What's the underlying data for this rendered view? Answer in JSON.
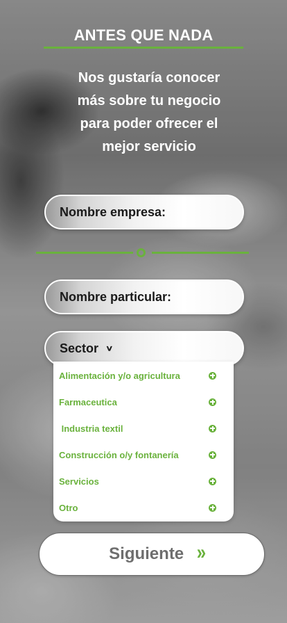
{
  "header": {
    "title": "ANTES QUE NADA",
    "intro": "Nos gustaría conocer\n más sobre tu negocio\npara poder ofrecer el\nmejor servicio"
  },
  "form": {
    "company_label": "Nombre empresa:",
    "individual_label": "Nombre particular:",
    "sector_label": "Sector",
    "sector_chevron": "∨",
    "sector_options": [
      "Alimentación y/o agricultura",
      "Farmaceutica",
      " Industria textil",
      "Construcción o/y fontanería",
      "Servicios",
      "Otro"
    ]
  },
  "footer": {
    "next_label": "Siguiente",
    "next_icon": "»"
  },
  "colors": {
    "accent": "#6ab23d",
    "text_dark": "#1a1a1a",
    "button_text": "#6e6e6e"
  },
  "icons": {
    "option_icon": "plus-circle-icon",
    "next_icon": "double-chevron-right-icon",
    "sector_icon": "chevron-down-icon",
    "divider_icon": "ring-icon"
  }
}
